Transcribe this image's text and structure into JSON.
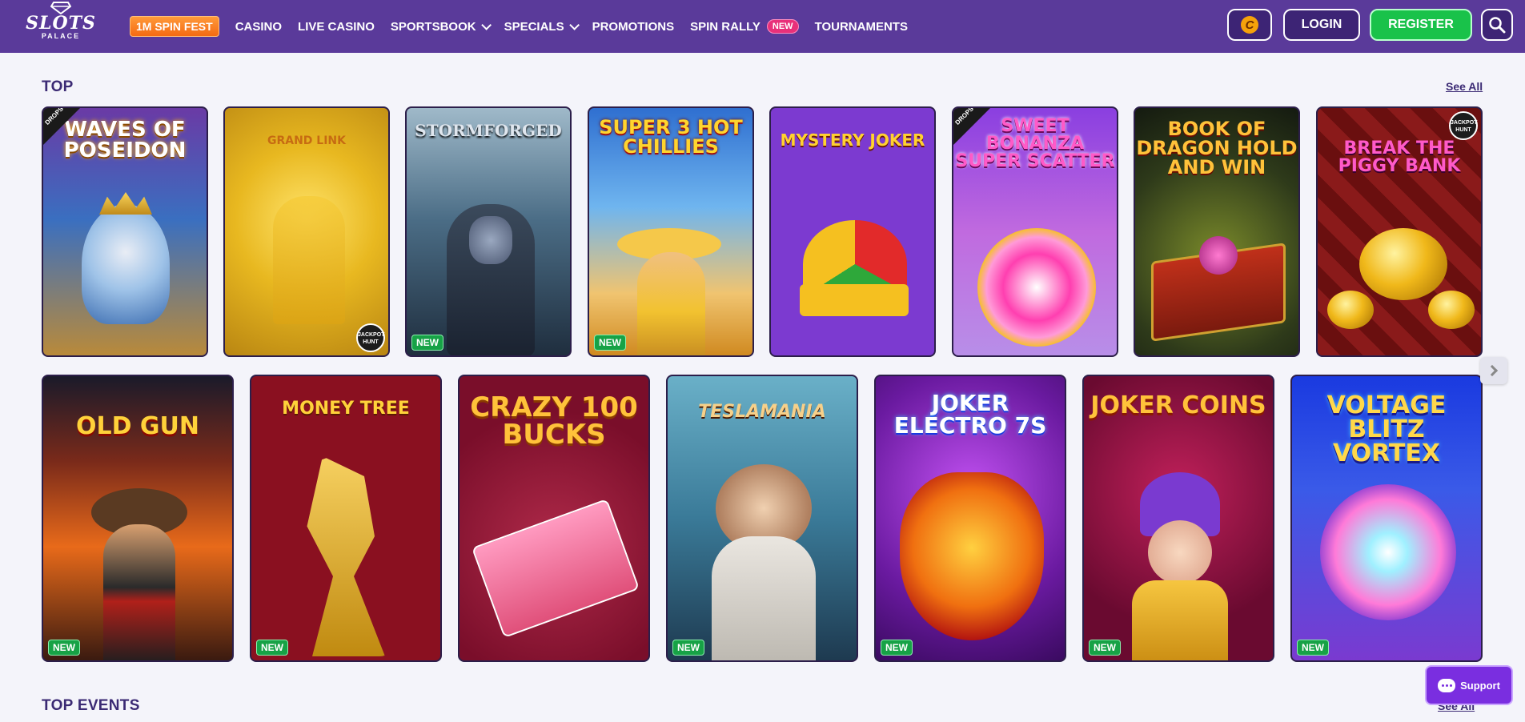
{
  "header": {
    "logo_brand": "SLOTS",
    "logo_sub": "PALACE",
    "nav": {
      "spin_fest": "1M SPIN FEST",
      "casino": "CASINO",
      "live_casino": "LIVE CASINO",
      "sportsbook": "SPORTSBOOK",
      "specials": "SPECIALS",
      "promotions": "PROMOTIONS",
      "spin_rally": "SPIN RALLY",
      "spin_rally_badge": "NEW",
      "tournaments": "TOURNAMENTS"
    },
    "coin_symbol": "C",
    "login": "LOGIN",
    "register": "REGISTER"
  },
  "top": {
    "title": "TOP",
    "see_all": "See All",
    "row1": [
      {
        "title": "WAVES OF POSEIDON",
        "corner": "DROPS & WINS"
      },
      {
        "title": "GRAND LINK",
        "badge": "JACKPOT HUNT"
      },
      {
        "title": "STORMFORGED",
        "badge": "NEW"
      },
      {
        "title": "SUPER 3 HOT CHILLIES",
        "badge": "NEW"
      },
      {
        "title": "MYSTERY JOKER"
      },
      {
        "title": "SWEET BONANZA SUPER SCATTER",
        "corner": "DROPS & WINS"
      },
      {
        "title": "BOOK OF DRAGON HOLD AND WIN"
      },
      {
        "title": "BREAK THE PIGGY BANK",
        "badge": "JACKPOT HUNT"
      }
    ],
    "row2": [
      {
        "title": "OLD GUN",
        "badge": "NEW"
      },
      {
        "title": "MONEY TREE",
        "badge": "NEW"
      },
      {
        "title": "CRAZY 100 BUCKS"
      },
      {
        "title": "TESLAMANIA",
        "badge": "NEW"
      },
      {
        "title": "JOKER ELECTRO 7s",
        "badge": "NEW"
      },
      {
        "title": "JOKER COINS",
        "badge": "NEW"
      },
      {
        "title": "VOLTAGE BLITZ VORTEX",
        "badge": "NEW"
      }
    ]
  },
  "top_events": {
    "title": "TOP EVENTS",
    "see_all": "See All"
  },
  "support": "Support",
  "colors": {
    "header_bg": "#5a3a9a",
    "register_green": "#19c24a",
    "spin_fest_orange": "#f56a12",
    "new_badge_green": "#17a246",
    "support_purple": "#7a2ee0"
  }
}
